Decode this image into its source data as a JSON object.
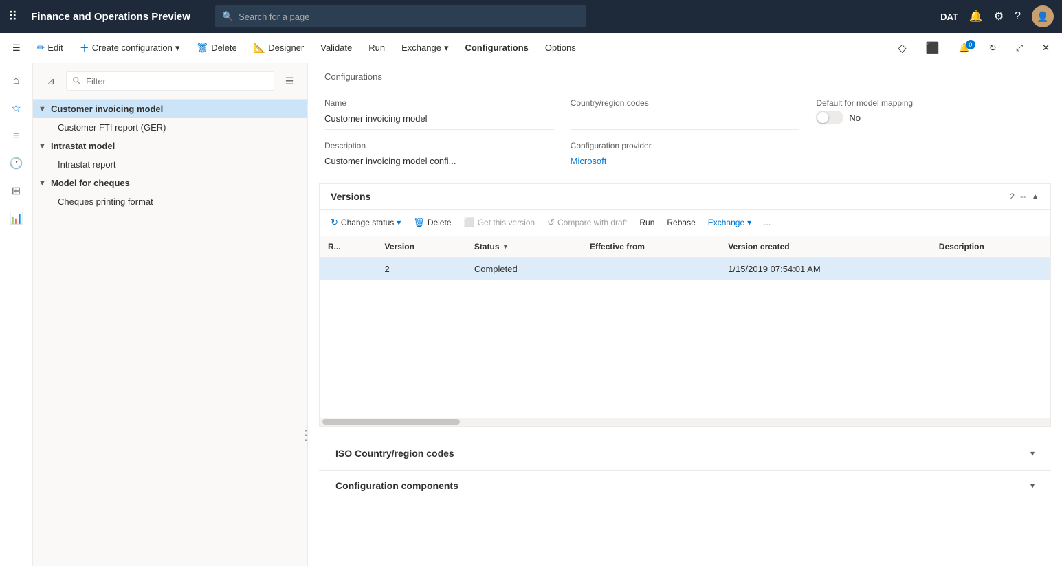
{
  "app": {
    "title": "Finance and Operations Preview",
    "search_placeholder": "Search for a page",
    "env": "DAT"
  },
  "command_bar": {
    "edit": "Edit",
    "create_configuration": "Create configuration",
    "delete": "Delete",
    "designer": "Designer",
    "validate": "Validate",
    "run": "Run",
    "exchange": "Exchange",
    "configurations": "Configurations",
    "options": "Options"
  },
  "tree": {
    "filter_placeholder": "Filter",
    "items": [
      {
        "id": "customer-invoicing-model",
        "label": "Customer invoicing model",
        "level": 0,
        "expandable": true,
        "expanded": true,
        "selected": true
      },
      {
        "id": "customer-fti-report",
        "label": "Customer FTI report (GER)",
        "level": 1,
        "expandable": false
      },
      {
        "id": "intrastat-model",
        "label": "Intrastat model",
        "level": 0,
        "expandable": true,
        "expanded": true
      },
      {
        "id": "intrastat-report",
        "label": "Intrastat report",
        "level": 1,
        "expandable": false
      },
      {
        "id": "model-for-cheques",
        "label": "Model for cheques",
        "level": 0,
        "expandable": true,
        "expanded": true
      },
      {
        "id": "cheques-printing-format",
        "label": "Cheques printing format",
        "level": 1,
        "expandable": false
      }
    ]
  },
  "configurations": {
    "breadcrumb": "Configurations",
    "name_label": "Name",
    "name_value": "Customer invoicing model",
    "country_label": "Country/region codes",
    "country_value": "",
    "default_mapping_label": "Default for model mapping",
    "default_mapping_value": "No",
    "description_label": "Description",
    "description_value": "Customer invoicing model confi...",
    "provider_label": "Configuration provider",
    "provider_value": "Microsoft"
  },
  "versions": {
    "title": "Versions",
    "count": "2",
    "separator": "--",
    "toolbar": {
      "change_status": "Change status",
      "delete": "Delete",
      "get_this_version": "Get this version",
      "compare_with_draft": "Compare with draft",
      "run": "Run",
      "rebase": "Rebase",
      "exchange": "Exchange",
      "more": "..."
    },
    "table": {
      "headers": [
        "R...",
        "Version",
        "Status",
        "Effective from",
        "Version created",
        "Description"
      ],
      "rows": [
        {
          "r": "",
          "version": "2",
          "status": "Completed",
          "effective_from": "",
          "version_created": "1/15/2019 07:54:01 AM",
          "description": "",
          "selected": true
        }
      ]
    }
  },
  "iso_section": {
    "title": "ISO Country/region codes",
    "collapsed": true
  },
  "components_section": {
    "title": "Configuration components",
    "collapsed": true
  }
}
